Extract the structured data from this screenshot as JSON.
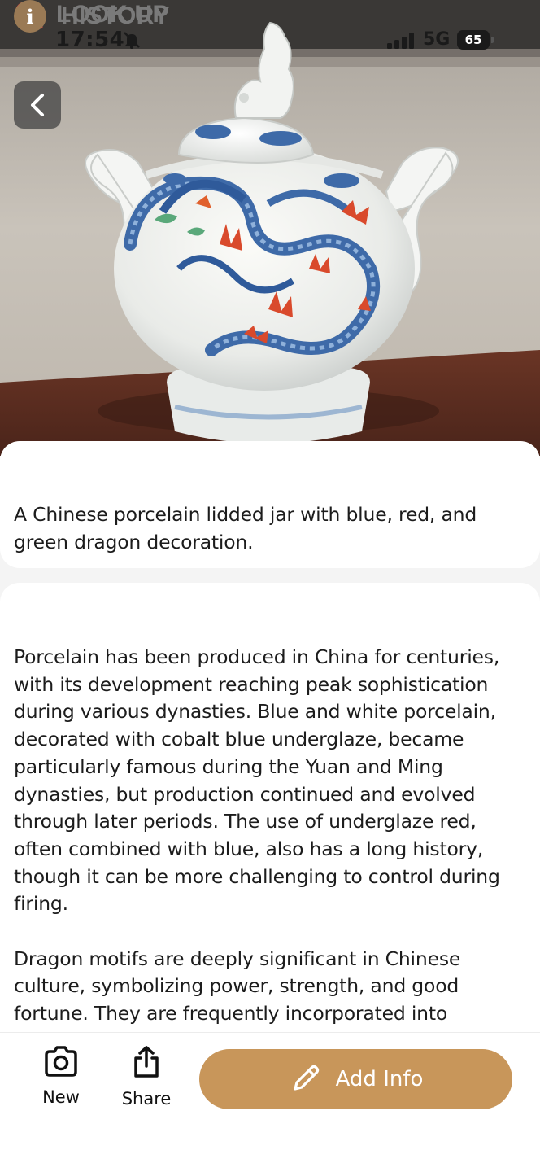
{
  "status_bar": {
    "time": "17:54",
    "network": "5G",
    "battery": "65",
    "icons": [
      "bell-off-icon",
      "signal-icon"
    ]
  },
  "header": {
    "back_icon": "chevron-left-icon"
  },
  "photo": {
    "icon": "porcelain-jar-photo"
  },
  "look_up": {
    "title": "LOOK UP",
    "icon": "search-icon",
    "text": "A Chinese porcelain lidded jar with blue, red, and green dragon decoration."
  },
  "history": {
    "title": "HISTORY",
    "icon": "info-icon",
    "icon_glyph": "i",
    "paragraphs": [
      "Porcelain has been produced in China for centuries, with its development reaching peak sophistication during various dynasties. Blue and white porcelain, decorated with cobalt blue underglaze, became particularly famous during the Yuan and Ming dynasties, but production continued and evolved through later periods. The use of underglaze red, often combined with blue, also has a long history, though it can be more challenging to control during firing.",
      "Dragon motifs are deeply significant in Chinese culture, symbolizing power, strength, and good fortune. They are frequently incorporated into"
    ]
  },
  "toolbar": {
    "new_label": "New",
    "share_label": "Share",
    "add_info_label": "Add Info",
    "icons": [
      "camera-icon",
      "share-icon",
      "pencil-icon"
    ]
  },
  "colors": {
    "accent": "#c8965a",
    "search_red": "#e8453c",
    "info_brown": "#9a7a55",
    "title_gray": "#7a7a7a"
  }
}
